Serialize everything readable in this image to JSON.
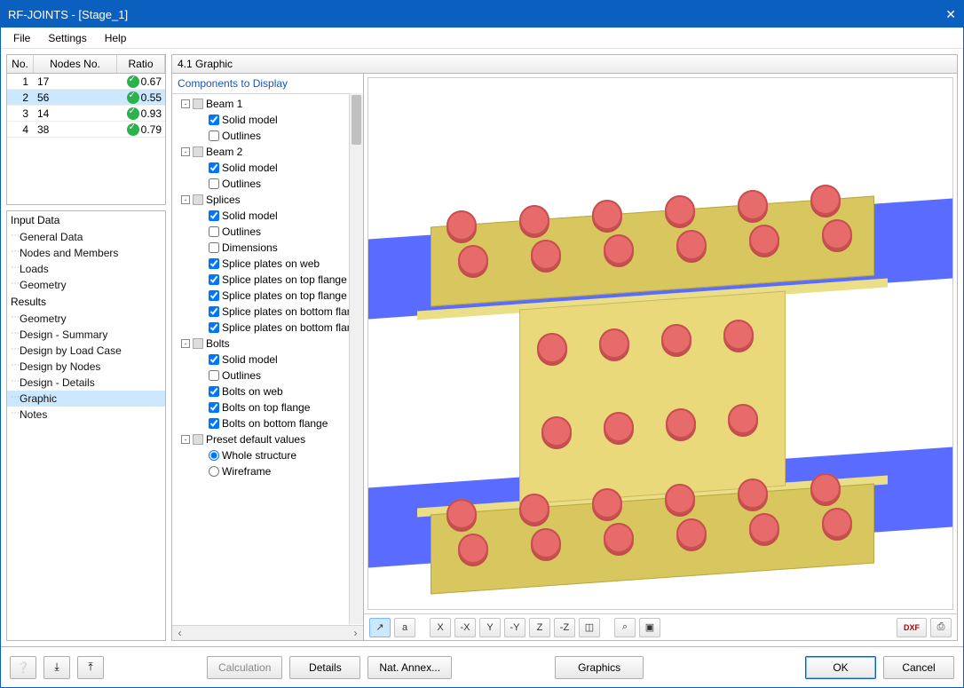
{
  "window": {
    "title": "RF-JOINTS - [Stage_1]"
  },
  "menu": {
    "file": "File",
    "settings": "Settings",
    "help": "Help"
  },
  "table": {
    "col_no": "No.",
    "col_nodes": "Nodes No.",
    "col_ratio": "Ratio",
    "rows": [
      {
        "no": "1",
        "nodes": "17",
        "ratio": "0.67",
        "selected": false
      },
      {
        "no": "2",
        "nodes": "56",
        "ratio": "0.55",
        "selected": true
      },
      {
        "no": "3",
        "nodes": "14",
        "ratio": "0.93",
        "selected": false
      },
      {
        "no": "4",
        "nodes": "38",
        "ratio": "0.79",
        "selected": false
      }
    ]
  },
  "nav": {
    "input_header": "Input Data",
    "input_items": [
      "General Data",
      "Nodes and Members",
      "Loads",
      "Geometry"
    ],
    "results_header": "Results",
    "results_items": [
      "Geometry",
      "Design - Summary",
      "Design by Load Case",
      "Design by Nodes",
      "Design - Details",
      "Graphic",
      "Notes"
    ],
    "selected": "Graphic"
  },
  "graphic": {
    "header": "4.1 Graphic",
    "tree_header": "Components to Display",
    "nodes": [
      {
        "d": 1,
        "exp": "-",
        "kind": "group",
        "label": "Beam 1"
      },
      {
        "d": 2,
        "kind": "check",
        "checked": true,
        "label": "Solid model"
      },
      {
        "d": 2,
        "kind": "check",
        "checked": false,
        "label": "Outlines"
      },
      {
        "d": 1,
        "exp": "-",
        "kind": "group",
        "label": "Beam 2"
      },
      {
        "d": 2,
        "kind": "check",
        "checked": true,
        "label": "Solid model"
      },
      {
        "d": 2,
        "kind": "check",
        "checked": false,
        "label": "Outlines"
      },
      {
        "d": 1,
        "exp": "-",
        "kind": "group",
        "label": "Splices"
      },
      {
        "d": 2,
        "kind": "check",
        "checked": true,
        "label": "Solid model"
      },
      {
        "d": 2,
        "kind": "check",
        "checked": false,
        "label": "Outlines"
      },
      {
        "d": 2,
        "kind": "check",
        "checked": false,
        "label": "Dimensions"
      },
      {
        "d": 2,
        "kind": "check",
        "checked": true,
        "label": "Splice plates on web"
      },
      {
        "d": 2,
        "kind": "check",
        "checked": true,
        "label": "Splice plates on top flange"
      },
      {
        "d": 2,
        "kind": "check",
        "checked": true,
        "label": "Splice plates on top flange"
      },
      {
        "d": 2,
        "kind": "check",
        "checked": true,
        "label": "Splice plates on bottom flan"
      },
      {
        "d": 2,
        "kind": "check",
        "checked": true,
        "label": "Splice plates on bottom flan"
      },
      {
        "d": 1,
        "exp": "-",
        "kind": "group",
        "label": "Bolts"
      },
      {
        "d": 2,
        "kind": "check",
        "checked": true,
        "label": "Solid model"
      },
      {
        "d": 2,
        "kind": "check",
        "checked": false,
        "label": "Outlines"
      },
      {
        "d": 2,
        "kind": "check",
        "checked": true,
        "label": "Bolts on web"
      },
      {
        "d": 2,
        "kind": "check",
        "checked": true,
        "label": "Bolts on top flange"
      },
      {
        "d": 2,
        "kind": "check",
        "checked": true,
        "label": "Bolts on bottom flange"
      },
      {
        "d": 1,
        "exp": "-",
        "kind": "group",
        "label": "Preset default values"
      },
      {
        "d": 2,
        "kind": "radio",
        "checked": true,
        "label": "Whole structure"
      },
      {
        "d": 2,
        "kind": "radio",
        "checked": false,
        "label": "Wireframe"
      }
    ]
  },
  "toolbar": {
    "axis": "↗",
    "text": "a",
    "vx": "X",
    "vxn": "-X",
    "vy": "Y",
    "vyn": "-Y",
    "vz": "Z",
    "vzn": "-Z",
    "iso": "◫",
    "zoom": "⌕",
    "clip": "▣",
    "dxf": "DXF",
    "print": "⎙"
  },
  "footer": {
    "calc": "Calculation",
    "details": "Details",
    "annex": "Nat. Annex...",
    "graphics": "Graphics",
    "ok": "OK",
    "cancel": "Cancel"
  }
}
